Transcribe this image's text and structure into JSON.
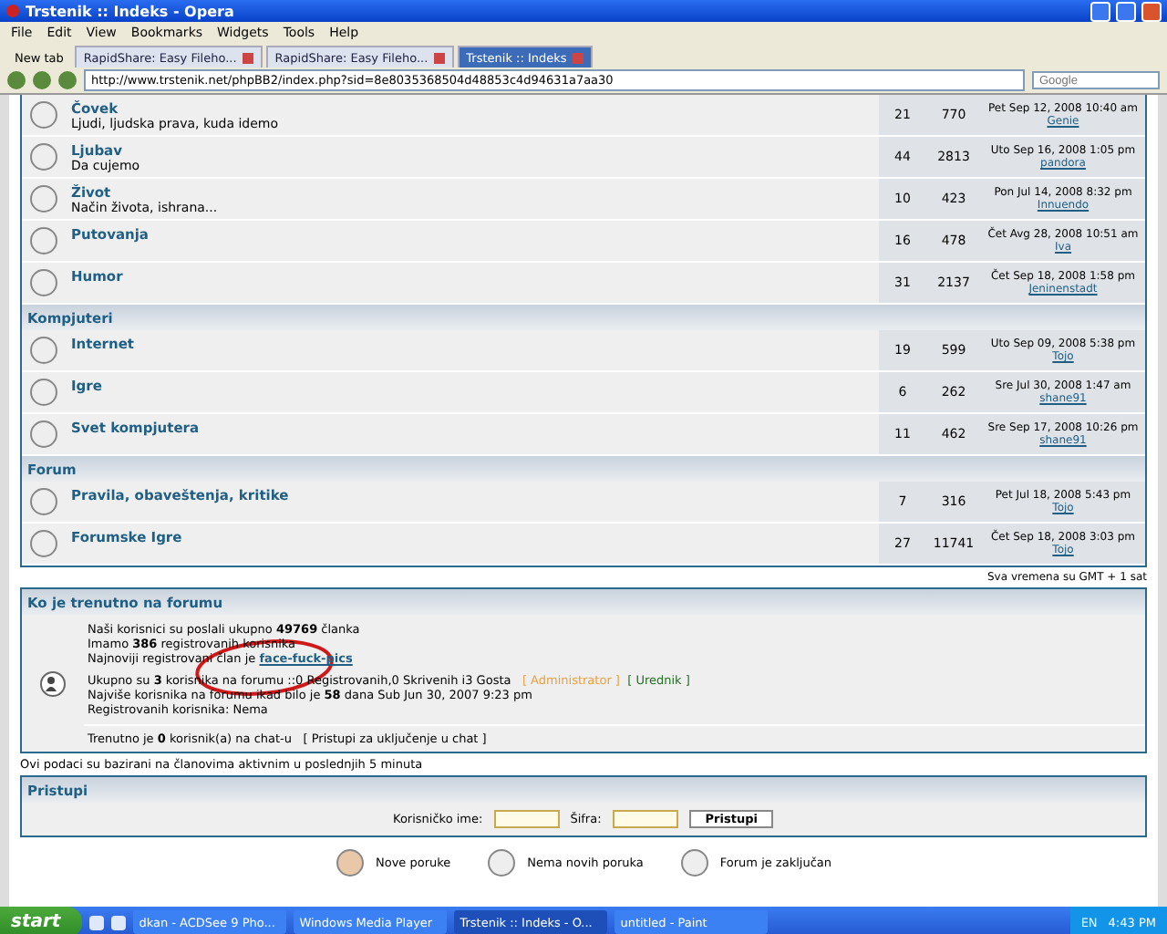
{
  "window": {
    "title": "Trstenik :: Indeks - Opera"
  },
  "menu": [
    "File",
    "Edit",
    "View",
    "Bookmarks",
    "Widgets",
    "Tools",
    "Help"
  ],
  "tabs": [
    {
      "label": "New tab",
      "kind": "new",
      "selected": false
    },
    {
      "label": "RapidShare: Easy Fileho...",
      "kind": "page",
      "selected": false
    },
    {
      "label": "RapidShare: Easy Fileho...",
      "kind": "page",
      "selected": false
    },
    {
      "label": "Trstenik :: Indeks",
      "kind": "page",
      "selected": true
    }
  ],
  "address": {
    "url": "http://www.trstenik.net/phpBB2/index.php?sid=8e8035368504d48853c4d94631a7aa30"
  },
  "search": {
    "placeholder": "Google"
  },
  "categories": [
    {
      "forums": [
        {
          "title": "Čovek",
          "description": "Ljudi, ljudska prava, kuda idemo",
          "topics": "21",
          "posts": "770",
          "last_post": "Pet Sep 12, 2008 10:40 am",
          "last_user": "Genie"
        },
        {
          "title": "Ljubav",
          "description": "Da cujemo",
          "topics": "44",
          "posts": "2813",
          "last_post": "Uto Sep 16, 2008 1:05 pm",
          "last_user": "pandora"
        },
        {
          "title": "Život",
          "description": "Način života, ishrana...",
          "topics": "10",
          "posts": "423",
          "last_post": "Pon Jul 14, 2008 8:32 pm",
          "last_user": "Innuendo"
        },
        {
          "title": "Putovanja",
          "topics": "16",
          "posts": "478",
          "last_post": "Čet Avg 28, 2008 10:51 am",
          "last_user": "Iva"
        },
        {
          "title": "Humor",
          "topics": "31",
          "posts": "2137",
          "last_post": "Čet Sep 18, 2008 1:58 pm",
          "last_user": "Jeninenstadt"
        }
      ]
    },
    {
      "title": "Kompjuteri",
      "forums": [
        {
          "title": "Internet",
          "topics": "19",
          "posts": "599",
          "last_post": "Uto Sep 09, 2008 5:38 pm",
          "last_user": "Tojo"
        },
        {
          "title": "Igre",
          "topics": "6",
          "posts": "262",
          "last_post": "Sre Jul 30, 2008 1:47 am",
          "last_user": "shane91"
        },
        {
          "title": "Svet kompjutera",
          "topics": "11",
          "posts": "462",
          "last_post": "Sre Sep 17, 2008 10:26 pm",
          "last_user": "shane91"
        }
      ]
    },
    {
      "title": "Forum",
      "forums": [
        {
          "title": "Pravila, obaveštenja, kritike",
          "topics": "7",
          "posts": "316",
          "last_post": "Pet Jul 18, 2008 5:43 pm",
          "last_user": "Tojo"
        },
        {
          "title": "Forumske Igre",
          "topics": "27",
          "posts": "11741",
          "last_post": "Čet Sep 18, 2008 3:03 pm",
          "last_user": "Tojo"
        }
      ]
    }
  ],
  "timezone_note": "Sva vremena su GMT + 1 sat",
  "online": {
    "title": "Ko je trenutno na forumu",
    "stats": [
      "Naši korisnici su poslali ukupno **49769** članka",
      "Imamo **386** registrovanih korisnika"
    ],
    "newest_prefix": "Najnoviji registrovani član je",
    "newest_user": "face-fuck-pics",
    "summary": "Ukupno su **3** korisnika na forumu ::0 Registrovanih,0 Skrivenih i3 Gosta",
    "admin": "[ Administrator ]",
    "moderator": "[ Urednik ]",
    "record": "Najviše korisnika na forumu ikad bilo je **58** dana Sub Jun 30, 2007 9:23 pm",
    "registered": "Registrovanih korisnika: Nema",
    "chat": "Trenutno je **0** korisnik(a) na chat-u",
    "chat_link": "[ Pristupi za uključenje u chat ]"
  },
  "online_note": "Ovi podaci su bazirani na članovima aktivnim u poslednjih 5 minuta",
  "login": {
    "title": "Pristupi",
    "username_label": "Korisničko ime:",
    "password_label": "Šifra:",
    "button": "Pristupi"
  },
  "legend": [
    "Nove poruke",
    "Nema novih poruka",
    "Forum je zaključan"
  ],
  "taskbar": {
    "start": "start",
    "tasks": [
      {
        "label": "dkan - ACDSee 9 Pho...",
        "selected": false
      },
      {
        "label": "Windows Media Player",
        "selected": false
      },
      {
        "label": "Trstenik :: Indeks - O...",
        "selected": true
      },
      {
        "label": "untitled - Paint",
        "selected": false
      }
    ],
    "language": "EN",
    "clock": "4:43 PM"
  }
}
